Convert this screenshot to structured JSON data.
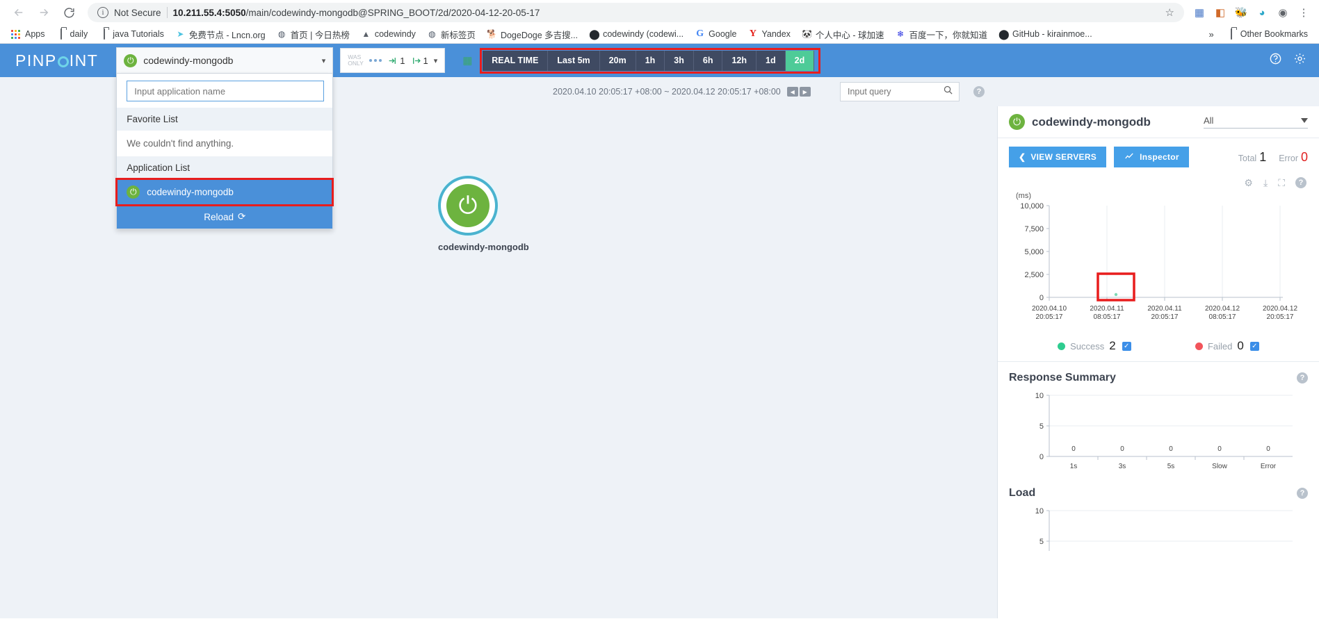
{
  "browser": {
    "back_icon": "back-arrow-icon",
    "forward_icon": "forward-arrow-icon",
    "reload_icon": "reload-icon",
    "security_label": "Not Secure",
    "url_host": "10.211.55.4:5050",
    "url_path": "/main/codewindy-mongodb@SPRING_BOOT/2d/2020-04-12-20-05-17",
    "url_full": "10.211.55.4:5050/main/codewindy-mongodb@SPRING_BOOT/2d/2020-04-12-20-05-17",
    "star_icon": "star-icon",
    "extensions": [
      "grid-extension-icon",
      "cast-icon",
      "honey-icon",
      "shield-extension-icon",
      "profile-avatar-icon",
      "menu-kebab-icon"
    ],
    "bookmarks": [
      {
        "label": "Apps",
        "icon": "apps-grid-icon"
      },
      {
        "label": "daily",
        "icon": "folder-icon"
      },
      {
        "label": "java Tutorials",
        "icon": "folder-icon"
      },
      {
        "label": "免费节点 - Lncn.org",
        "icon": "paper-plane-icon"
      },
      {
        "label": "首页 | 今日热榜",
        "icon": "globe-icon"
      },
      {
        "label": "codewindy",
        "icon": "mountain-icon"
      },
      {
        "label": "新标签页",
        "icon": "globe-icon"
      },
      {
        "label": "DogeDoge 多吉搜...",
        "icon": "dog-icon"
      },
      {
        "label": "codewindy (codewi...",
        "icon": "github-icon"
      },
      {
        "label": "Google",
        "icon": "google-g-icon"
      },
      {
        "label": "Yandex",
        "icon": "yandex-y-icon"
      },
      {
        "label": "个人中心 - 球加速",
        "icon": "panda-icon"
      },
      {
        "label": "百度一下，你就知道",
        "icon": "baidu-icon"
      },
      {
        "label": "GitHub - kirainmoe...",
        "icon": "github-icon"
      }
    ],
    "overflow_label": "»",
    "other_bookmarks_label": "Other Bookmarks",
    "other_bookmarks_icon": "folder-icon"
  },
  "header": {
    "logo_text_left": "PINP",
    "logo_text_right": "INT",
    "app_selector": {
      "value": "codewindy-mongodb",
      "app_icon": "spring-boot-icon",
      "caret_icon": "chevron-down-icon"
    },
    "dropdown": {
      "search_placeholder": "Input application name",
      "search_value": "",
      "favorite_list_label": "Favorite List",
      "favorite_empty_text": "We couldn't find anything.",
      "application_list_label": "Application List",
      "applications": [
        {
          "name": "codewindy-mongodb",
          "icon": "spring-boot-icon",
          "highlighted": true
        }
      ],
      "reload_label": "Reload",
      "reload_icon": "refresh-icon"
    },
    "servers": {
      "was_only_line1": "WAS",
      "was_only_line2": "ONLY",
      "dots_icon": "node-dots-icon",
      "inbound_icon": "inbound-arrow-icon",
      "inbound_count": "1",
      "outbound_icon": "outbound-arrow-icon",
      "outbound_count": "1",
      "caret_icon": "chevron-down-icon"
    },
    "time_range": {
      "calendar_icon": "calendar-icon",
      "options": [
        {
          "label": "REAL TIME",
          "active": false
        },
        {
          "label": "Last 5m",
          "active": false
        },
        {
          "label": "20m",
          "active": false
        },
        {
          "label": "1h",
          "active": false
        },
        {
          "label": "3h",
          "active": false
        },
        {
          "label": "6h",
          "active": false
        },
        {
          "label": "12h",
          "active": false
        },
        {
          "label": "1d",
          "active": false
        },
        {
          "label": "2d",
          "active": true
        }
      ],
      "highlight_color": "#e81d1d"
    },
    "help_icon": "help-circle-icon",
    "settings_icon": "gear-icon"
  },
  "subbar": {
    "time_label": "2020.04.10 20:05:17 +08:00 ~ 2020.04.12 20:05:17 +08:00",
    "prev_icon": "step-back-icon",
    "next_icon": "step-forward-icon",
    "query_placeholder": "Input query",
    "query_value": "",
    "search_icon": "search-icon",
    "help_icon": "help-circle-icon"
  },
  "servermap": {
    "node_label": "codewindy-mongodb",
    "node_icon": "spring-boot-icon"
  },
  "right_panel": {
    "title": "codewindy-mongodb",
    "title_icon": "spring-boot-icon",
    "filter_value": "All",
    "filter_caret_icon": "triangle-down-icon",
    "view_servers_label": "VIEW SERVERS",
    "view_servers_icon": "chevron-left-icon",
    "inspector_label": "Inspector",
    "inspector_icon": "chart-line-icon",
    "total_label": "Total",
    "total_value": "1",
    "error_label": "Error",
    "error_value": "0",
    "chart_tools": [
      "gear-icon",
      "download-icon",
      "expand-icon",
      "help-circle-icon"
    ],
    "legend": [
      {
        "label": "Success",
        "value": "2",
        "color": "#2ecc8f",
        "checked": true
      },
      {
        "label": "Failed",
        "value": "0",
        "color": "#f2545b",
        "checked": true
      }
    ],
    "response_summary_title": "Response Summary",
    "response_summary_help_icon": "help-circle-icon",
    "load_title": "Load",
    "load_help_icon": "help-circle-icon"
  },
  "chart_data": [
    {
      "type": "scatter",
      "title": "",
      "ylabel": "(ms)",
      "xlabel": "",
      "ylim": [
        0,
        10000
      ],
      "yticks": [
        0,
        2500,
        5000,
        7500,
        10000
      ],
      "ytick_labels": [
        "0",
        "2,500",
        "5,000",
        "7,500",
        "10,000"
      ],
      "xtick_labels": [
        "2020.04.10\n20:05:17",
        "2020.04.11\n08:05:17",
        "2020.04.11\n20:05:17",
        "2020.04.12\n08:05:17",
        "2020.04.12\n20:05:17"
      ],
      "xticks_line1": [
        "2020.04.10",
        "2020.04.11",
        "2020.04.11",
        "2020.04.12",
        "2020.04.12"
      ],
      "xticks_line2": [
        "20:05:17",
        "08:05:17",
        "20:05:17",
        "08:05:17",
        "20:05:17"
      ],
      "series": [
        {
          "name": "Success",
          "color": "#7ed9b5",
          "points": [
            {
              "x": "2020.04.11 09:30",
              "y": 120
            }
          ]
        },
        {
          "name": "Failed",
          "color": "#f2545b",
          "points": []
        }
      ],
      "grid": true,
      "annotation": {
        "type": "rect-highlight",
        "color": "#e81d1d"
      }
    },
    {
      "type": "bar",
      "title": "Response Summary",
      "categories": [
        "1s",
        "3s",
        "5s",
        "Slow",
        "Error"
      ],
      "values": [
        0,
        0,
        0,
        0,
        0
      ],
      "data_labels": [
        "0",
        "0",
        "0",
        "0",
        "0"
      ],
      "ylim": [
        0,
        10
      ],
      "yticks": [
        0,
        5,
        10
      ],
      "ytick_labels": [
        "0",
        "5",
        "10"
      ],
      "xlabel": "",
      "ylabel": "",
      "grid": true
    },
    {
      "type": "bar",
      "title": "Load",
      "categories": [],
      "values": [],
      "ylim": [
        0,
        10
      ],
      "yticks": [
        5,
        10
      ],
      "ytick_labels": [
        "5",
        "10"
      ],
      "xlabel": "",
      "ylabel": "",
      "grid": true
    }
  ]
}
